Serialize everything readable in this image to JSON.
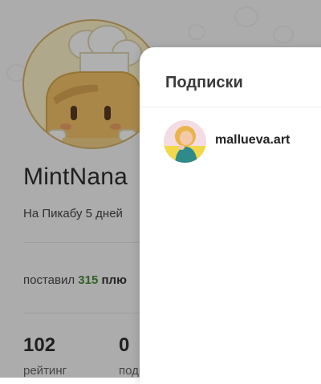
{
  "profile": {
    "username": "MintNana",
    "on_site": "На Пикабу 5 дней",
    "gave_prefix": "поставил",
    "gave_count": "315",
    "gave_suffix": "плю",
    "stats": [
      {
        "value": "102",
        "label": "рейтинг"
      },
      {
        "value": "0",
        "label": "подписчиков"
      }
    ]
  },
  "modal": {
    "title": "Подписки",
    "items": [
      {
        "name": "mallueva.art"
      }
    ]
  },
  "colors": {
    "accent_green": "#4b8b37",
    "overlay": "rgba(0,0,0,0.31)"
  }
}
